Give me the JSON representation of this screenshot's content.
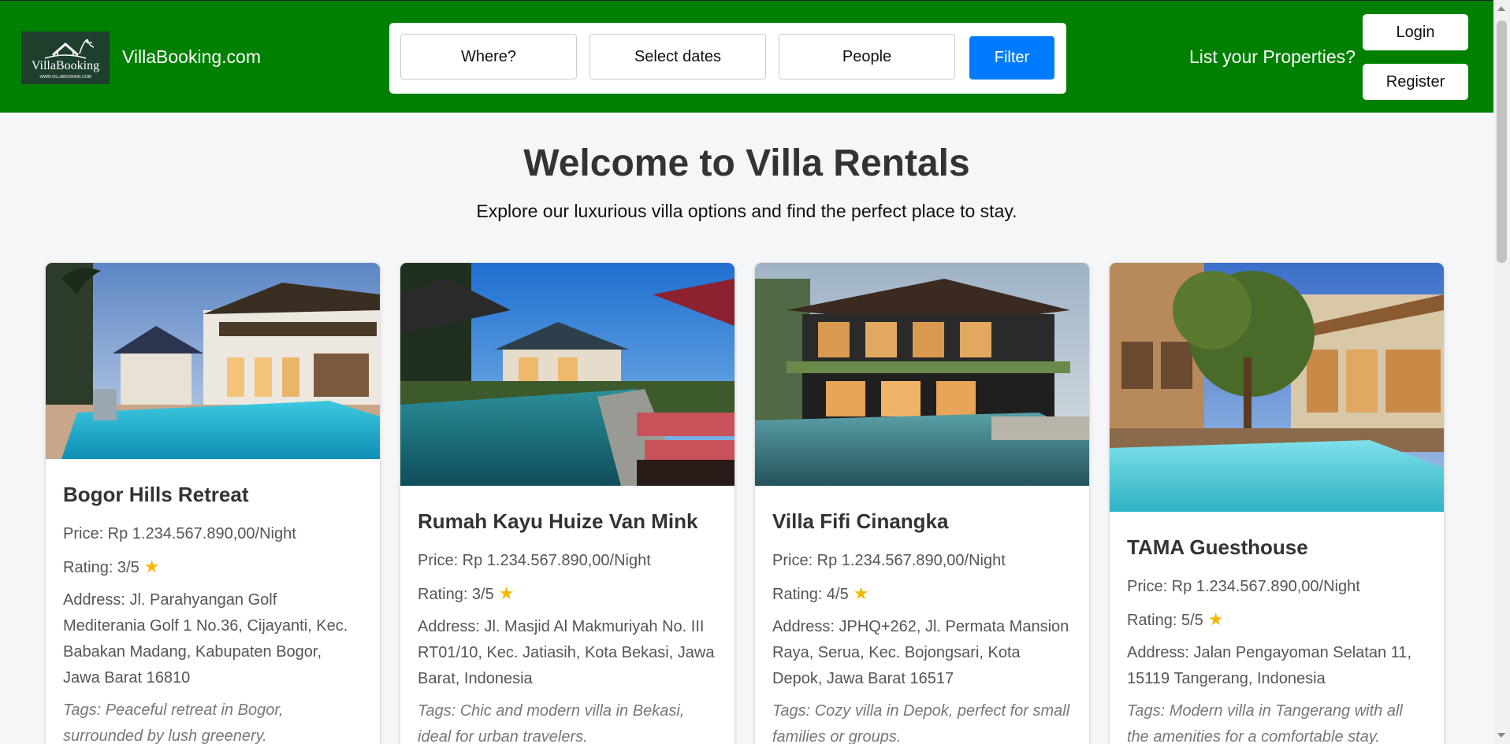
{
  "header": {
    "logo_text": "VillaBooking",
    "logo_subtext": "WWW.VILLABOOKING.COM",
    "site_name": "VillaBooking.com",
    "search": {
      "where": "Where?",
      "dates": "Select dates",
      "people": "People",
      "filter": "Filter"
    },
    "list_properties": "List your Properties?",
    "login": "Login",
    "register": "Register"
  },
  "hero": {
    "title": "Welcome to Villa Rentals",
    "subtitle": "Explore our luxurious villa options and find the perfect place to stay."
  },
  "villas": [
    {
      "name": "Bogor Hills Retreat",
      "price": "Price: Rp 1.234.567.890,00/Night",
      "rating": "Rating: 3/5",
      "address": "Address: Jl. Parahyangan Golf Mediterania Golf 1 No.36, Cijayanti, Kec. Babakan Madang, Kabupaten Bogor, Jawa Barat 16810",
      "tags": "Tags: Peaceful retreat in Bogor, surrounded by lush greenery."
    },
    {
      "name": "Rumah Kayu Huize Van Mink",
      "price": "Price: Rp 1.234.567.890,00/Night",
      "rating": "Rating: 3/5",
      "address": "Address: Jl. Masjid Al Makmuriyah No. III RT01/10, Kec. Jatiasih, Kota Bekasi, Jawa Barat, Indonesia",
      "tags": "Tags: Chic and modern villa in Bekasi, ideal for urban travelers."
    },
    {
      "name": "Villa Fifi Cinangka",
      "price": "Price: Rp 1.234.567.890,00/Night",
      "rating": "Rating: 4/5",
      "address": "Address: JPHQ+262, Jl. Permata Mansion Raya, Serua, Kec. Bojongsari, Kota Depok, Jawa Barat 16517",
      "tags": "Tags: Cozy villa in Depok, perfect for small families or groups."
    },
    {
      "name": "TAMA Guesthouse",
      "price": "Price: Rp 1.234.567.890,00/Night",
      "rating": "Rating: 5/5",
      "address": "Address: Jalan Pengayoman Selatan 11, 15119 Tangerang, Indonesia",
      "tags": "Tags: Modern villa in Tangerang with all the amenities for a comfortable stay."
    }
  ],
  "icons": {
    "star": "★"
  },
  "colors": {
    "header_bg": "#008000",
    "filter_bg": "#007bff",
    "star": "#f5b800"
  }
}
